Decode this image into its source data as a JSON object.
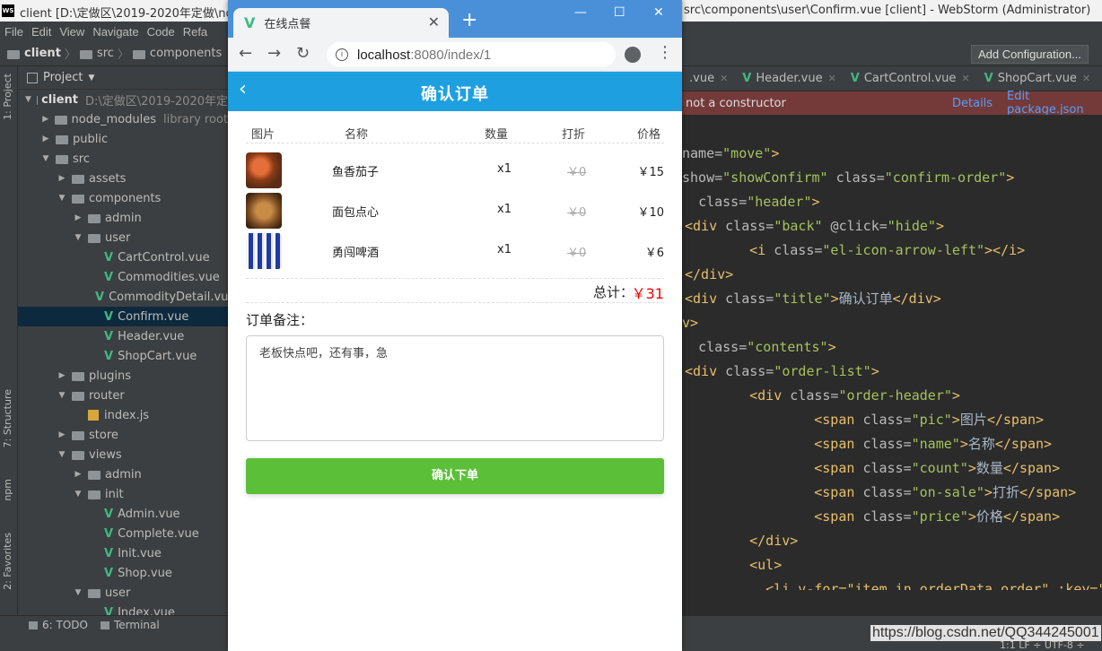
{
  "ide": {
    "title_left": "client [D:\\定做区\\2019-2020年定做\\nc",
    "title_right": "src\\components\\user\\Confirm.vue [client] - WebStorm (Administrator)",
    "menu": [
      "File",
      "Edit",
      "View",
      "Navigate",
      "Code",
      "Refa"
    ],
    "breadcrumb": [
      "client",
      "src",
      "components"
    ],
    "add_configuration": "Add Configuration...",
    "side_labels": [
      "1: Project",
      "7: Structure",
      "npm",
      "2: Favorites"
    ],
    "project_header": "Project",
    "tree": [
      {
        "label": "client",
        "hint": "D:\\定做区\\2019-2020年定",
        "type": "root"
      },
      {
        "label": "node_modules",
        "hint": "library root",
        "type": "folder"
      },
      {
        "label": "public",
        "type": "folder"
      },
      {
        "label": "src",
        "type": "folder"
      },
      {
        "label": "assets",
        "type": "folder"
      },
      {
        "label": "components",
        "type": "folder"
      },
      {
        "label": "admin",
        "type": "folder"
      },
      {
        "label": "user",
        "type": "folder"
      },
      {
        "label": "CartControl.vue",
        "type": "vue"
      },
      {
        "label": "Commodities.vue",
        "type": "vue"
      },
      {
        "label": "CommodityDetail.vu",
        "type": "vue"
      },
      {
        "label": "Confirm.vue",
        "type": "vue"
      },
      {
        "label": "Header.vue",
        "type": "vue"
      },
      {
        "label": "ShopCart.vue",
        "type": "vue"
      },
      {
        "label": "plugins",
        "type": "folder"
      },
      {
        "label": "router",
        "type": "folder"
      },
      {
        "label": "index.js",
        "type": "js"
      },
      {
        "label": "store",
        "type": "folder"
      },
      {
        "label": "views",
        "type": "folder"
      },
      {
        "label": "admin",
        "type": "folder"
      },
      {
        "label": "init",
        "type": "folder"
      },
      {
        "label": "Admin.vue",
        "type": "vue"
      },
      {
        "label": "Complete.vue",
        "type": "vue"
      },
      {
        "label": "Init.vue",
        "type": "vue"
      },
      {
        "label": "Shop.vue",
        "type": "vue"
      },
      {
        "label": "user",
        "type": "folder"
      },
      {
        "label": "Index.vue",
        "type": "vue"
      }
    ],
    "tabs": [
      ".vue",
      "Header.vue",
      "CartControl.vue",
      "ShopCart.vue"
    ],
    "error_text": "not a constructor",
    "error_details": "Details",
    "error_edit": "Edit package.json",
    "code": [
      {
        "a": "name=",
        "v": "\"move\"",
        "t": ">"
      },
      {
        "a": "show=",
        "v": "\"showConfirm\"",
        "b": " class=",
        "v2": "\"confirm-order\"",
        "t": ">"
      },
      {
        "p": "  ",
        "a": "class=",
        "v": "\"header\"",
        "t": ">"
      },
      {
        "p": "<div ",
        "a": "class=",
        "v": "\"back\"",
        "b": " @click=",
        "v2": "\"hide\"",
        "t": ">"
      },
      {
        "p": "    <i ",
        "a": "class=",
        "v": "\"el-icon-arrow-left\"",
        "t": "></i>"
      },
      {
        "p": "</div>"
      },
      {
        "p": "<div ",
        "a": "class=",
        "v": "\"title\"",
        "t": ">",
        "x": "确认订单",
        "e": "</div>"
      },
      {
        "p": "v>"
      },
      {
        "p": "  ",
        "a": "class=",
        "v": "\"contents\"",
        "t": ">"
      },
      {
        "p": "<div ",
        "a": "class=",
        "v": "\"order-list\"",
        "t": ">"
      },
      {
        "p": "    <div ",
        "a": "class=",
        "v": "\"order-header\"",
        "t": ">"
      },
      {
        "p": "        <span ",
        "a": "class=",
        "v": "\"pic\"",
        "t": ">",
        "x": "图片",
        "e": "</span>"
      },
      {
        "p": "        <span ",
        "a": "class=",
        "v": "\"name\"",
        "t": ">",
        "x": "名称",
        "e": "</span>"
      },
      {
        "p": "        <span ",
        "a": "class=",
        "v": "\"count\"",
        "t": ">",
        "x": "数量",
        "e": "</span>"
      },
      {
        "p": "        <span ",
        "a": "class=",
        "v": "\"on-sale\"",
        "t": ">",
        "x": "打折",
        "e": "</span>"
      },
      {
        "p": "        <span ",
        "a": "class=",
        "v": "\"price\"",
        "t": ">",
        "x": "价格",
        "e": "</span>"
      },
      {
        "p": "    </div>"
      },
      {
        "p": "    <ul>"
      },
      {
        "p": "      <li v-for=\"item in orderData.order\" :key=\"it"
      }
    ],
    "status_todo": "6: TODO",
    "status_terminal": "Terminal",
    "watermark": "https://blog.csdn.net/QQ344245001",
    "status_right": "1:1  LF ÷  UTF-8 ÷"
  },
  "browser": {
    "tab_title": "在线点餐",
    "tab_close": "✕",
    "new_tab": "+",
    "url_host": "localhost",
    "url_path": ":8080/index/1"
  },
  "app": {
    "back": "‹",
    "title": "确认订单",
    "headers": {
      "pic": "图片",
      "name": "名称",
      "count": "数量",
      "sale": "打折",
      "price": "价格"
    },
    "items": [
      {
        "name": "鱼香茄子",
        "count": "x1",
        "sale": "￥0",
        "price": "￥15"
      },
      {
        "name": "面包点心",
        "count": "x1",
        "sale": "￥0",
        "price": "￥10"
      },
      {
        "name": "勇闯啤酒",
        "count": "x1",
        "sale": "￥0",
        "price": "￥6"
      }
    ],
    "total_label": "总计：",
    "total_value": "￥31",
    "note_label": "订单备注：",
    "note_value": "老板快点吧，还有事，急",
    "submit": "确认下单"
  }
}
